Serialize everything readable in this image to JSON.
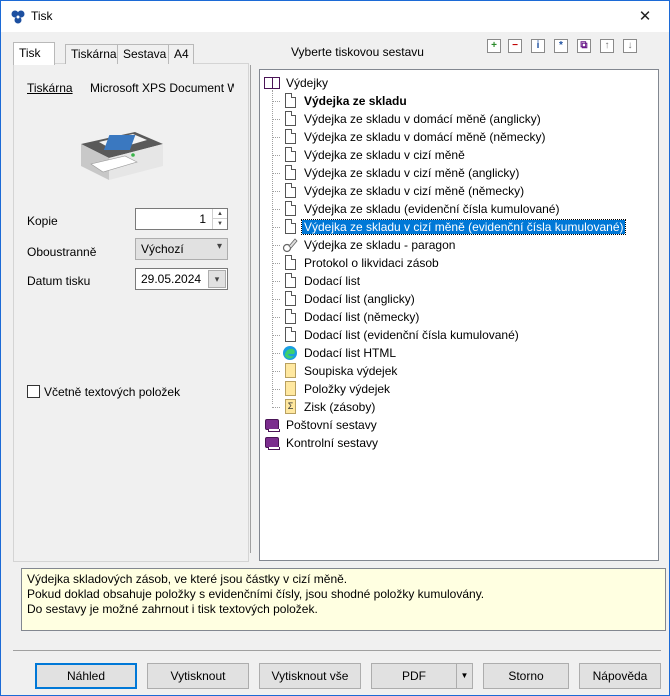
{
  "window": {
    "title": "Tisk",
    "close_glyph": "✕"
  },
  "tabs": [
    {
      "label": "Tisk",
      "active": true
    },
    {
      "label": "Tiskárna",
      "active": false
    },
    {
      "label": "Sestava",
      "active": false
    },
    {
      "label": "A4",
      "active": false
    }
  ],
  "left": {
    "printer_label": "Tiskárna",
    "printer_name": "Microsoft XPS Document W",
    "copies_label": "Kopie",
    "copies_value": "1",
    "duplex_label": "Oboustranně",
    "duplex_value": "Výchozí",
    "date_label": "Datum tisku",
    "date_value": "29.05.2024",
    "include_text_items_label": "Včetně textových položek",
    "include_text_items_checked": false
  },
  "right": {
    "heading": "Vyberte tiskovou sestavu",
    "toolbar": [
      {
        "icon": "add-icon",
        "glyph": "+",
        "color": "#2a8a2a"
      },
      {
        "icon": "remove-icon",
        "glyph": "−",
        "color": "#c00000"
      },
      {
        "icon": "info-icon",
        "glyph": "i",
        "color": "#1c4fa0"
      },
      {
        "icon": "edit-icon",
        "glyph": "*",
        "color": "#1c4fa0"
      },
      {
        "icon": "copy-icon",
        "glyph": "⧉",
        "color": "#6a1a8a"
      },
      {
        "icon": "move-up-icon",
        "glyph": "↑",
        "color": "#777777"
      },
      {
        "icon": "move-down-icon",
        "glyph": "↓",
        "color": "#777777"
      }
    ],
    "tree": {
      "root_label": "Výdejky",
      "children": [
        {
          "label": "Výdejka ze skladu",
          "bold": true,
          "icon": "document-icon"
        },
        {
          "label": "Výdejka ze skladu v domácí měně (anglicky)",
          "icon": "document-icon"
        },
        {
          "label": "Výdejka ze skladu v domácí měně (německy)",
          "icon": "document-icon"
        },
        {
          "label": "Výdejka ze skladu v cizí měně",
          "icon": "document-icon"
        },
        {
          "label": "Výdejka ze skladu v cizí měně (anglicky)",
          "icon": "document-icon"
        },
        {
          "label": "Výdejka ze skladu v cizí měně (německy)",
          "icon": "document-icon"
        },
        {
          "label": "Výdejka ze skladu (evidenční čísla kumulované)",
          "icon": "document-icon"
        },
        {
          "label": "Výdejka ze skladu v cizí měně (evidenční čísla kumulované)",
          "icon": "document-icon",
          "selected": true
        },
        {
          "label": "Výdejka ze skladu - paragon",
          "icon": "receipt-icon"
        },
        {
          "label": "Protokol o likvidaci zásob",
          "icon": "document-icon"
        },
        {
          "label": "Dodací list",
          "icon": "document-icon"
        },
        {
          "label": "Dodací list (anglicky)",
          "icon": "document-icon"
        },
        {
          "label": "Dodací list (německy)",
          "icon": "document-icon"
        },
        {
          "label": "Dodací list (evidenční čísla kumulované)",
          "icon": "document-icon"
        },
        {
          "label": "Dodací list HTML",
          "icon": "edge-browser-icon"
        },
        {
          "label": "Soupiska výdejek",
          "icon": "yellow-document-icon"
        },
        {
          "label": "Položky výdejek",
          "icon": "yellow-document-icon"
        },
        {
          "label": "Zisk (zásoby)",
          "icon": "sum-document-icon"
        }
      ],
      "other_roots": [
        {
          "label": "Poštovní sestavy",
          "icon": "book-icon"
        },
        {
          "label": "Kontrolní sestavy",
          "icon": "book-icon"
        }
      ]
    }
  },
  "description": [
    "Výdejka skladových zásob, ve které jsou částky v cizí měně.",
    "Pokud doklad obsahuje položky s evidenčními čísly, jsou shodné položky kumulovány.",
    "Do sestavy je možné zahrnout i tisk textových položek."
  ],
  "buttons": {
    "preview": "Náhled",
    "print": "Vytisknout",
    "print_all": "Vytisknout vše",
    "pdf": "PDF",
    "cancel": "Storno",
    "help": "Nápověda"
  }
}
